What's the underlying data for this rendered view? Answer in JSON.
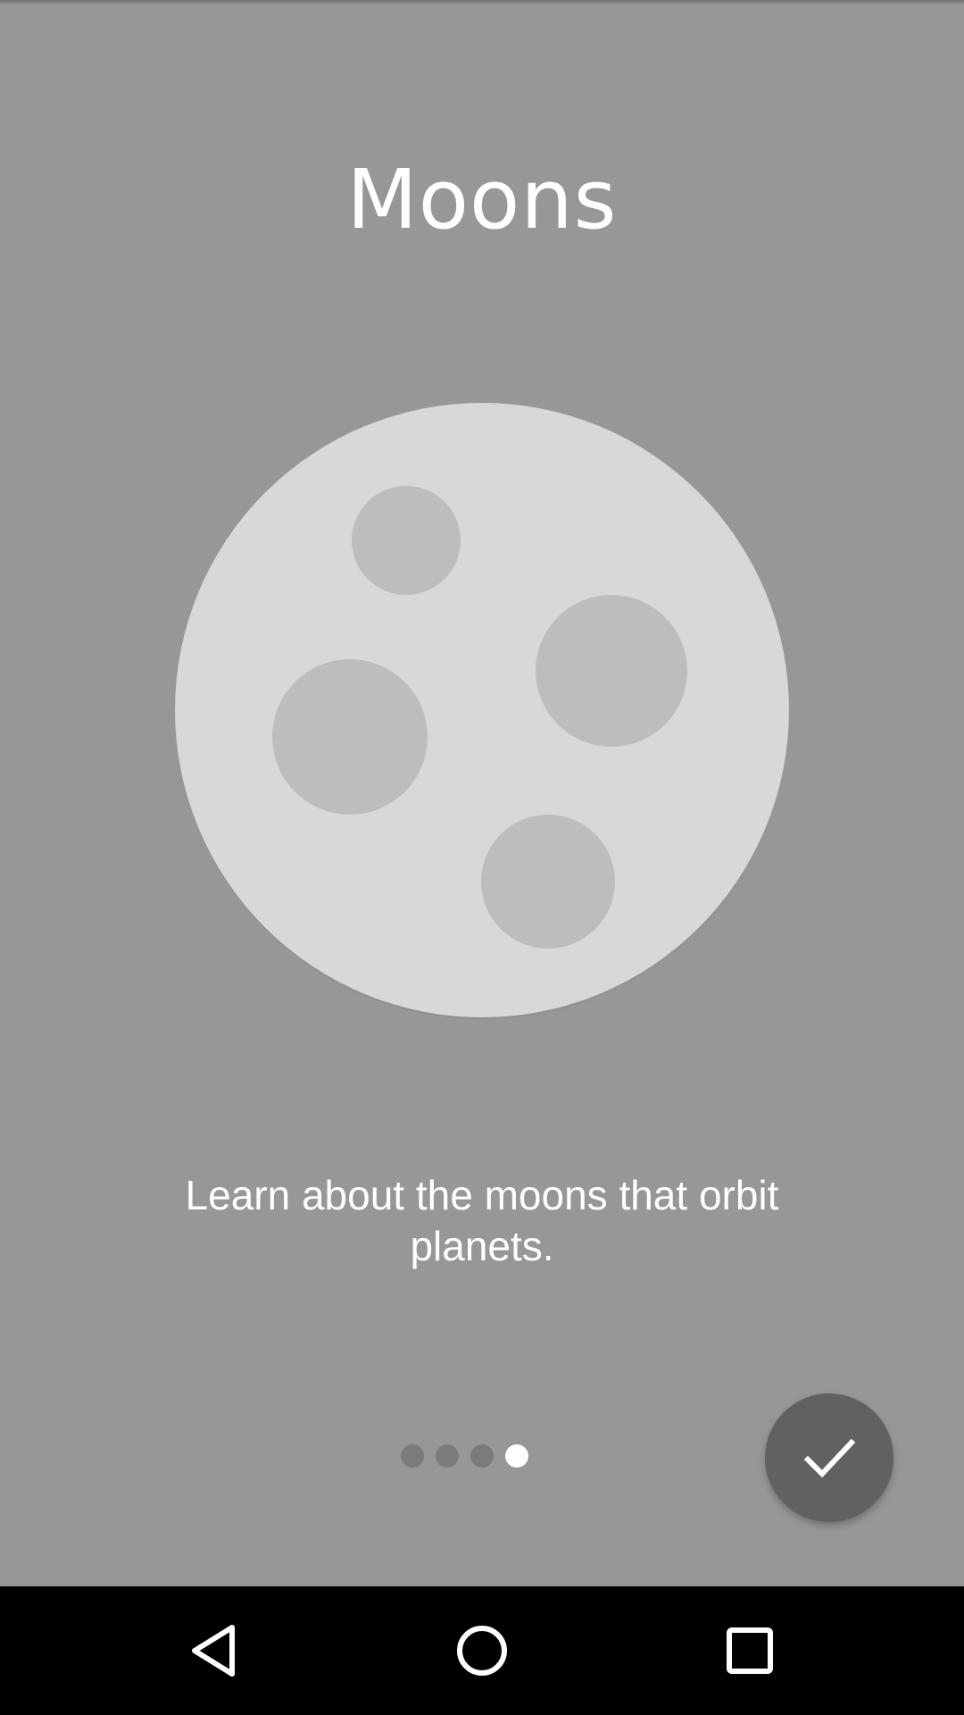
{
  "screen": {
    "title": "Moons",
    "description": "Learn about the moons that orbit planets.",
    "pager": {
      "page_count": 4,
      "current_page": 4
    },
    "fab": {
      "icon": "check-icon"
    },
    "colors": {
      "background": "#979797",
      "moon": "#d8d8d8",
      "crater": "#bdbdbd",
      "fab": "#616161",
      "dot_inactive": "#7b7b7b",
      "dot_active": "#ffffff"
    }
  },
  "navbar": {
    "back_icon": "back-triangle-icon",
    "home_icon": "home-circle-icon",
    "recents_icon": "recents-square-icon"
  }
}
